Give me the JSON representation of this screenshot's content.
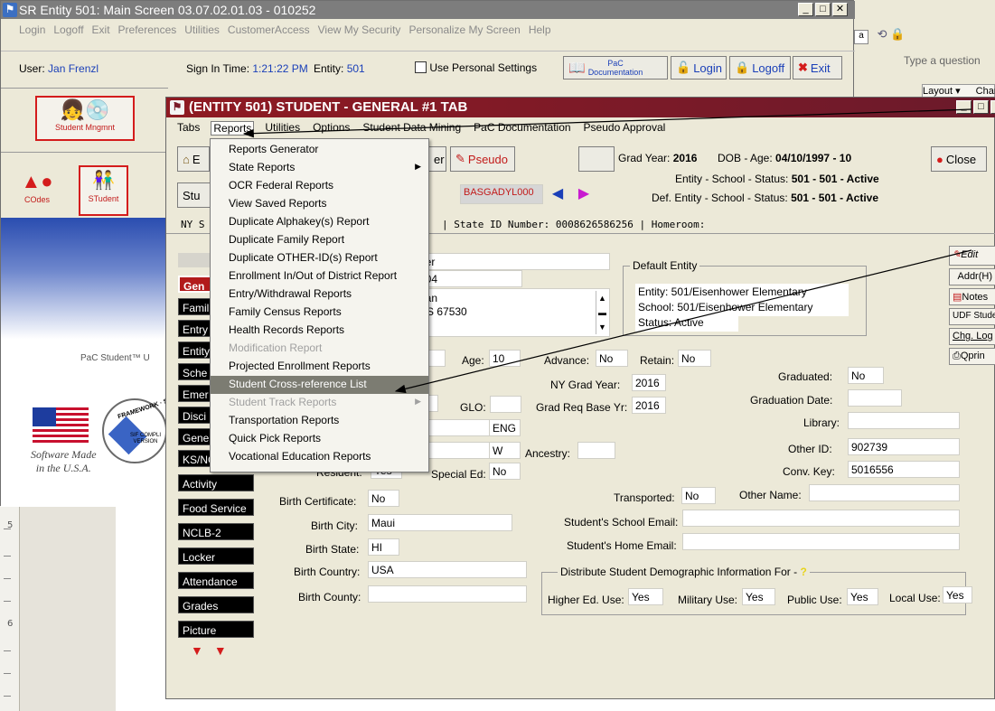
{
  "word": {
    "ask_placeholder": "Type a question",
    "layout_label": "Layout ▾",
    "chang_label": "Chang",
    "ruler_marks": [
      "5",
      "6"
    ]
  },
  "main_window": {
    "title": "SR Entity 501: Main Screen 03.07.02.01.03 - 010252",
    "menu": [
      "Login",
      "Logoff",
      "Exit",
      "Preferences",
      "Utilities",
      "CustomerAccess",
      "View My Security",
      "Personalize My Screen",
      "Help"
    ],
    "user_label": "User:",
    "user_value": "Jan Frenzl",
    "signin_label": "Sign In Time:",
    "signin_value": "1:21:22 PM",
    "entity_label": "Entity:",
    "entity_value": "501",
    "personal_settings": "Use Personal Settings",
    "pac_doc_top": "PaC",
    "pac_doc_bottom": "Documentation",
    "login_btn": "Login",
    "logoff_btn": "Logoff",
    "exit_btn": "Exit"
  },
  "left_nav": {
    "student_mngmnt": "Student Mngmnt",
    "codes": "COdes",
    "student": "STudent",
    "pac_student": "PaC Student™ U",
    "software_made_1": "Software Made",
    "software_made_2": "in the U.S.A.",
    "badge_text": "SIF COMPLI VERSION",
    "badge_arc": "FRAMEWORK · SIF ·"
  },
  "student_window": {
    "title": "(ENTITY 501) STUDENT - GENERAL #1 TAB",
    "menu": [
      "Tabs",
      "Reports",
      "Utilities",
      "Options",
      "Student Data Mining",
      "PaC Documentation",
      "Pseudo Approval"
    ],
    "toolbar": {
      "btn_e": "E",
      "btn_er": "er",
      "pseudo": "Pseudo",
      "close": "Close",
      "stu_label": "Stu",
      "alphakey": "BASGADYL000"
    },
    "header": {
      "grad_year_label": "Grad Year:",
      "grad_year": "2016",
      "dob_label": "DOB - Age:",
      "dob": "04/10/1997 - 10",
      "entity_status_label": "Entity - School - Status:",
      "entity_status": "501 - 501 - Active",
      "def_status_label": "Def. Entity - School - Status:",
      "def_status": "501 - 501 - Active"
    },
    "id_line": {
      "prefix": "NY S",
      "state_id_label": "|   State ID Number: 0008626586256   |   Homeroom:"
    },
    "side_tabs": [
      "Gen",
      "Famil",
      "Entry",
      "Entity",
      "Sche",
      "Emer",
      "Disci",
      "Gene",
      "KS/NCLB",
      "Activity",
      "Food Service",
      "NCLB-2",
      "Locker",
      "Attendance",
      "Grades",
      "Picture"
    ],
    "address": {
      "line1": "her",
      "line2": "704",
      "line3": "nan",
      "line4": "KS 67530"
    },
    "default_entity": {
      "title": "Default Entity",
      "entity": "Entity: 501/Eisenhower Elementary",
      "school": "School: 501/Eisenhower Elementary",
      "status": "Status: Active"
    },
    "right_buttons": [
      "Edit",
      "Addr(H)",
      "Notes",
      "UDF Studen",
      "Chg. Log",
      "Qprin"
    ],
    "fields": {
      "age_label": "Age:",
      "age": "10",
      "advance_label": "Advance:",
      "advance": "No",
      "retain_label": "Retain:",
      "retain": "No",
      "graduated_label": "Graduated:",
      "graduated": "No",
      "ny_grad_year_label": "NY Grad Year:",
      "ny_grad_year": "2016",
      "graduation_date_label": "Graduation Date:",
      "graduation_date": "",
      "glo_label": "GLO:",
      "glo": "",
      "grad_req_label": "Grad Req Base Yr:",
      "grad_req": "2016",
      "library_label": "Library:",
      "library": "",
      "lang": "ENG",
      "race": "W",
      "ancestry_label": "Ancestry:",
      "ancestry": "",
      "other_id_label": "Other ID:",
      "other_id": "902739",
      "resident_label": "Resident:",
      "resident": "Yes",
      "special_ed_label": "Special Ed:",
      "special_ed": "No",
      "conv_key_label": "Conv. Key:",
      "conv_key": "5016556",
      "birth_cert_label": "Birth Certificate:",
      "birth_cert": "No",
      "transported_label": "Transported:",
      "transported": "No",
      "other_name_label": "Other Name:",
      "other_name": "",
      "birth_city_label": "Birth City:",
      "birth_city": "Maui",
      "school_email_label": "Student's School Email:",
      "school_email": "",
      "birth_state_label": "Birth State:",
      "birth_state": "HI",
      "home_email_label": "Student's Home Email:",
      "home_email": "",
      "birth_country_label": "Birth Country:",
      "birth_country": "USA",
      "birth_county_label": "Birth County:",
      "birth_county": ""
    },
    "distribute": {
      "title": "Distribute Student Demographic Information For -",
      "higher_ed_label": "Higher Ed. Use:",
      "higher_ed": "Yes",
      "military_label": "Military Use:",
      "military": "Yes",
      "public_label": "Public Use:",
      "public": "Yes",
      "local_label": "Local Use:",
      "local": "Yes"
    }
  },
  "reports_menu": {
    "items": [
      {
        "label": "Reports Generator",
        "state": "normal"
      },
      {
        "label": "State Reports",
        "state": "submenu"
      },
      {
        "label": "OCR Federal Reports",
        "state": "normal"
      },
      {
        "label": "View Saved Reports",
        "state": "normal"
      },
      {
        "label": "Duplicate Alphakey(s) Report",
        "state": "normal"
      },
      {
        "label": "Duplicate Family Report",
        "state": "normal"
      },
      {
        "label": "Duplicate OTHER-ID(s) Report",
        "state": "normal"
      },
      {
        "label": "Enrollment In/Out of District Report",
        "state": "normal"
      },
      {
        "label": "Entry/Withdrawal Reports",
        "state": "normal"
      },
      {
        "label": "Family Census Reports",
        "state": "normal"
      },
      {
        "label": "Health Records Reports",
        "state": "normal"
      },
      {
        "label": "Modification Report",
        "state": "disabled"
      },
      {
        "label": "Projected Enrollment Reports",
        "state": "normal"
      },
      {
        "label": "Student Cross-reference List",
        "state": "highlighted"
      },
      {
        "label": "Student Track Reports",
        "state": "disabled-submenu"
      },
      {
        "label": "Transportation Reports",
        "state": "normal"
      },
      {
        "label": "Quick Pick Reports",
        "state": "normal"
      },
      {
        "label": "Vocational Education Reports",
        "state": "normal"
      }
    ]
  },
  "colors": {
    "title_bar": "#7a1a28",
    "highlight": "#7c7c72",
    "link_blue": "#1a3fb8",
    "nav_border": "#d41c1c"
  }
}
